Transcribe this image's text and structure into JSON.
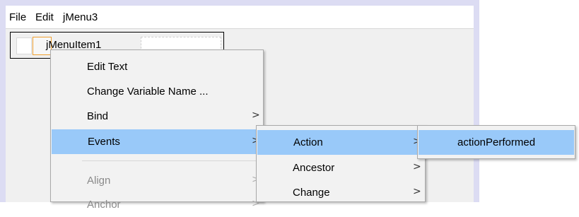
{
  "menubar": {
    "items": [
      {
        "label": "File"
      },
      {
        "label": "Edit"
      },
      {
        "label": "jMenu3"
      }
    ]
  },
  "designer_menu": {
    "item_label": "jMenuItem1"
  },
  "context_menu": {
    "items": [
      {
        "label": "Edit Text",
        "submenu": false,
        "enabled": true,
        "highlighted": false
      },
      {
        "label": "Change Variable Name ...",
        "submenu": false,
        "enabled": true,
        "highlighted": false
      },
      {
        "label": "Bind",
        "submenu": true,
        "enabled": true,
        "highlighted": false
      },
      {
        "label": "Events",
        "submenu": true,
        "enabled": true,
        "highlighted": true
      },
      {
        "label": "Align",
        "submenu": true,
        "enabled": false,
        "highlighted": false
      },
      {
        "label": "Anchor",
        "submenu": true,
        "enabled": false,
        "highlighted": false
      }
    ]
  },
  "events_submenu": {
    "items": [
      {
        "label": "Action",
        "submenu": true,
        "highlighted": true
      },
      {
        "label": "Ancestor",
        "submenu": true,
        "highlighted": false
      },
      {
        "label": "Change",
        "submenu": true,
        "highlighted": false
      }
    ]
  },
  "action_submenu": {
    "items": [
      {
        "label": "actionPerformed",
        "submenu": false,
        "highlighted": true
      }
    ]
  },
  "glyphs": {
    "submenu_arrow": ">"
  },
  "colors": {
    "highlight": "#99c9f9",
    "frame": "#dcdcf3",
    "menu_bg": "#f2f2f2",
    "form_bg": "#f0f0f0"
  }
}
